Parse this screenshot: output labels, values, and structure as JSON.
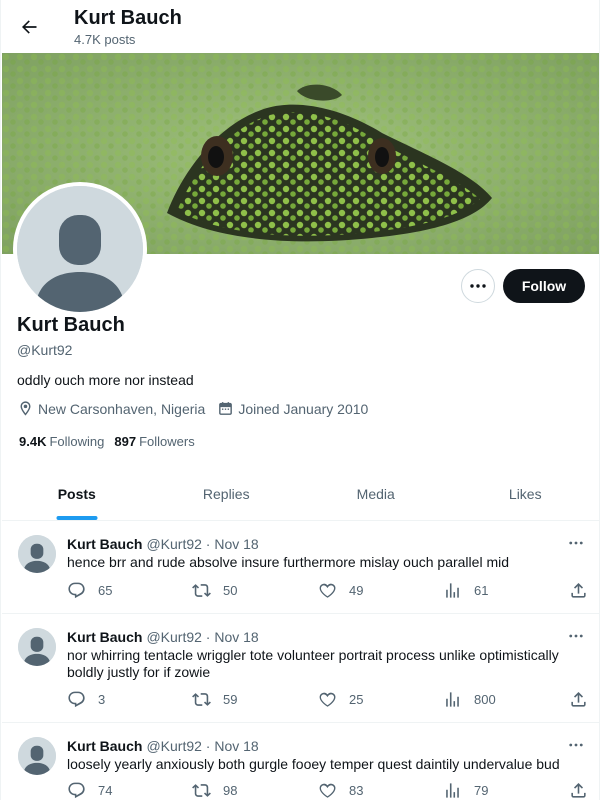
{
  "header": {
    "name": "Kurt Bauch",
    "post_count": "4.7K posts"
  },
  "profile": {
    "name": "Kurt Bauch",
    "handle": "@Kurt92",
    "bio": "oddly ouch more nor instead",
    "location": "New Carsonhaven, Nigeria",
    "joined": "Joined January 2010",
    "following_count": "9.4K",
    "following_label": "Following",
    "followers_count": "897",
    "followers_label": "Followers",
    "follow_label": "Follow"
  },
  "tabs": [
    {
      "label": "Posts",
      "active": true
    },
    {
      "label": "Replies",
      "active": false
    },
    {
      "label": "Media",
      "active": false
    },
    {
      "label": "Likes",
      "active": false
    }
  ],
  "posts": [
    {
      "name": "Kurt Bauch",
      "meta": "@Kurt92 · Nov 18",
      "text": "hence brr and rude absolve insure furthermore mislay ouch parallel mid",
      "replies": "65",
      "reposts": "50",
      "likes": "49",
      "views": "61"
    },
    {
      "name": "Kurt Bauch",
      "meta": "@Kurt92 · Nov 18",
      "text": "nor whirring tentacle wriggler tote volunteer portrait process unlike optimistically boldly justly for if zowie",
      "replies": "3",
      "reposts": "59",
      "likes": "25",
      "views": "800"
    },
    {
      "name": "Kurt Bauch",
      "meta": "@Kurt92 · Nov 18",
      "text": "loosely yearly anxiously both gurgle fooey temper quest daintily undervalue bud",
      "replies": "74",
      "reposts": "98",
      "likes": "83",
      "views": "79"
    }
  ],
  "colors": {
    "accent": "#1d9bf0",
    "follow_bg": "#0f1419",
    "muted_text": "#536471"
  },
  "icons": [
    "back-arrow-icon",
    "more-icon",
    "location-icon",
    "calendar-icon",
    "reply-icon",
    "repost-icon",
    "like-icon",
    "views-icon",
    "share-icon"
  ]
}
